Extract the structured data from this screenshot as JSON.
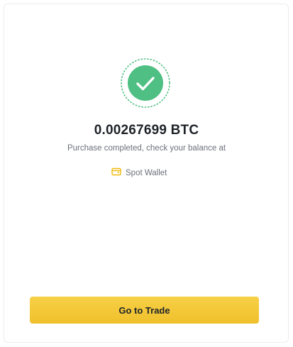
{
  "result": {
    "amount": "0.00267699 BTC",
    "message": "Purchase completed, check your balance at"
  },
  "wallet_link": {
    "label": "Spot Wallet",
    "icon": "wallet-icon"
  },
  "status_icon": "check-circle-icon",
  "primary_button": {
    "label": "Go to Trade"
  },
  "colors": {
    "success": "#4fbf83",
    "success_dots": "#4fbf83",
    "accent": "#f0c02c",
    "wallet_icon": "#f0b90b",
    "text_primary": "#1e2329",
    "text_secondary": "#6b7079"
  }
}
